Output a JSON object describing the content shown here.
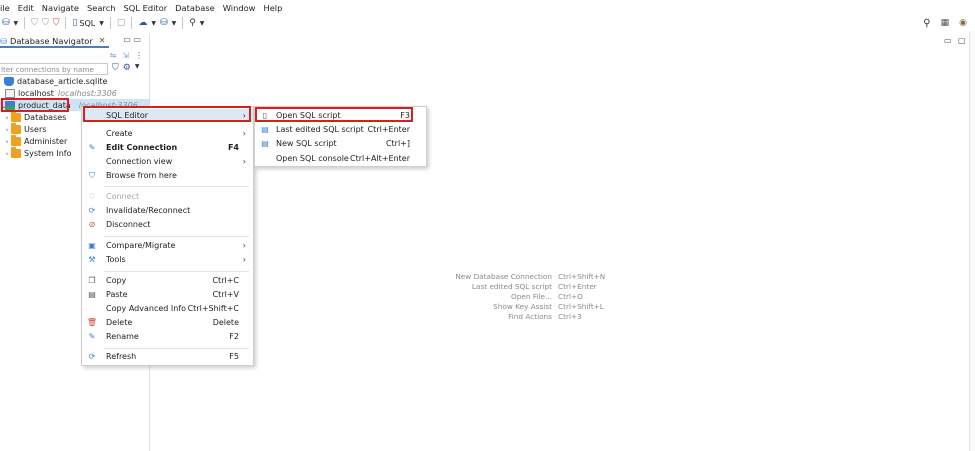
{
  "menubar": {
    "items": [
      "ile",
      "Edit",
      "Navigate",
      "Search",
      "SQL Editor",
      "Database",
      "Window",
      "Help"
    ]
  },
  "toolbar": {
    "sql_label": "SQL"
  },
  "navigator": {
    "tab_title": "Database Navigator",
    "filter_placeholder": "lter connections by name",
    "tree": [
      {
        "label": "database_article.sqlite",
        "sub": ""
      },
      {
        "label": "localhost",
        "sub": "localhost:3306"
      },
      {
        "label": "product_data",
        "sub": "localhost:3306"
      },
      {
        "label": "Databases",
        "sub": ""
      },
      {
        "label": "Users",
        "sub": ""
      },
      {
        "label": "Administer",
        "sub": ""
      },
      {
        "label": "System Info",
        "sub": ""
      }
    ]
  },
  "context_menu": {
    "items": [
      {
        "label": "SQL Editor",
        "shortcut": "",
        "submenu": true,
        "icon": "none"
      },
      {
        "label": "Create",
        "shortcut": "",
        "submenu": true,
        "icon": "none"
      },
      {
        "label": "Edit Connection",
        "shortcut": "F4",
        "submenu": false,
        "icon": "pencil-icon"
      },
      {
        "label": "Connection view",
        "shortcut": "",
        "submenu": true,
        "icon": "none"
      },
      {
        "label": "Browse from here",
        "shortcut": "",
        "submenu": false,
        "icon": "browse-icon"
      },
      {
        "label": "Connect",
        "shortcut": "",
        "submenu": false,
        "icon": "connect-icon"
      },
      {
        "label": "Invalidate/Reconnect",
        "shortcut": "",
        "submenu": false,
        "icon": "reconnect-icon"
      },
      {
        "label": "Disconnect",
        "shortcut": "",
        "submenu": false,
        "icon": "disconnect-icon"
      },
      {
        "label": "Compare/Migrate",
        "shortcut": "",
        "submenu": true,
        "icon": "compare-icon"
      },
      {
        "label": "Tools",
        "shortcut": "",
        "submenu": true,
        "icon": "tools-icon"
      },
      {
        "label": "Copy",
        "shortcut": "Ctrl+C",
        "submenu": false,
        "icon": "copy-icon"
      },
      {
        "label": "Paste",
        "shortcut": "Ctrl+V",
        "submenu": false,
        "icon": "paste-icon"
      },
      {
        "label": "Copy Advanced Info",
        "shortcut": "Ctrl+Shift+C",
        "submenu": false,
        "icon": "none"
      },
      {
        "label": "Delete",
        "shortcut": "Delete",
        "submenu": false,
        "icon": "delete-icon"
      },
      {
        "label": "Rename",
        "shortcut": "F2",
        "submenu": false,
        "icon": "rename-icon"
      },
      {
        "label": "Refresh",
        "shortcut": "F5",
        "submenu": false,
        "icon": "refresh-icon"
      }
    ]
  },
  "sql_submenu": {
    "items": [
      {
        "label": "Open SQL script",
        "shortcut": "F3"
      },
      {
        "label": "Last edited SQL script",
        "shortcut": "Ctrl+Enter"
      },
      {
        "label": "New SQL script",
        "shortcut": "Ctrl+]"
      },
      {
        "label": "Open SQL console",
        "shortcut": "Ctrl+Alt+Enter"
      }
    ]
  },
  "editor_hints": [
    {
      "action": "New Database Connection",
      "keys": "Ctrl+Shift+N"
    },
    {
      "action": "Last edited SQL script",
      "keys": "Ctrl+Enter"
    },
    {
      "action": "Open File...",
      "keys": "Ctrl+O"
    },
    {
      "action": "Show Key Assist",
      "keys": "Ctrl+Shift+L"
    },
    {
      "action": "Find Actions",
      "keys": "Ctrl+3"
    }
  ],
  "colors": {
    "accent": "#3a7fd1",
    "highlight": "#d62020",
    "selection": "#cfe3f7"
  }
}
